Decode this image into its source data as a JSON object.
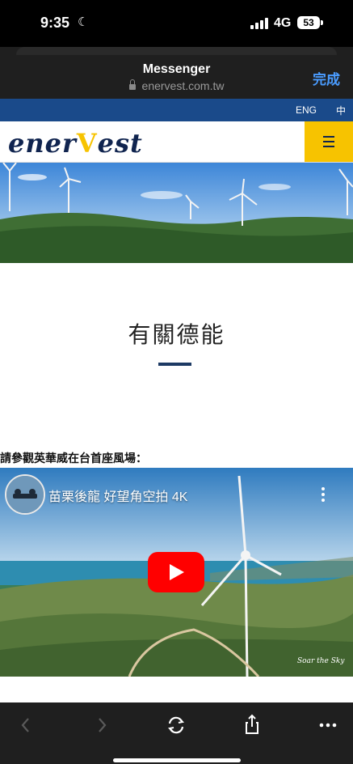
{
  "status_bar": {
    "time": "9:35",
    "network": "4G",
    "battery": "53"
  },
  "browser": {
    "title": "Messenger",
    "url": "enervest.com.tw",
    "done_label": "完成"
  },
  "site": {
    "lang_en": "ENG",
    "lang_zh": "中",
    "logo_text_1": "ener",
    "logo_text_v": "V",
    "logo_text_2": "est",
    "heading": "有關德能",
    "intro": "請參觀英華威在台首座風場：",
    "video": {
      "title": "苗栗後龍 好望角空拍 4K",
      "watermark": "Soar the Sky"
    }
  },
  "colors": {
    "brand_blue": "#1a4a8a",
    "brand_navy": "#10244f",
    "brand_yellow": "#f7c300",
    "play_red": "#ff0000",
    "link_blue": "#4a9cff"
  },
  "toolbar_icons": [
    "chevron-left-icon",
    "chevron-right-icon",
    "reload-icon",
    "share-icon",
    "more-icon"
  ]
}
